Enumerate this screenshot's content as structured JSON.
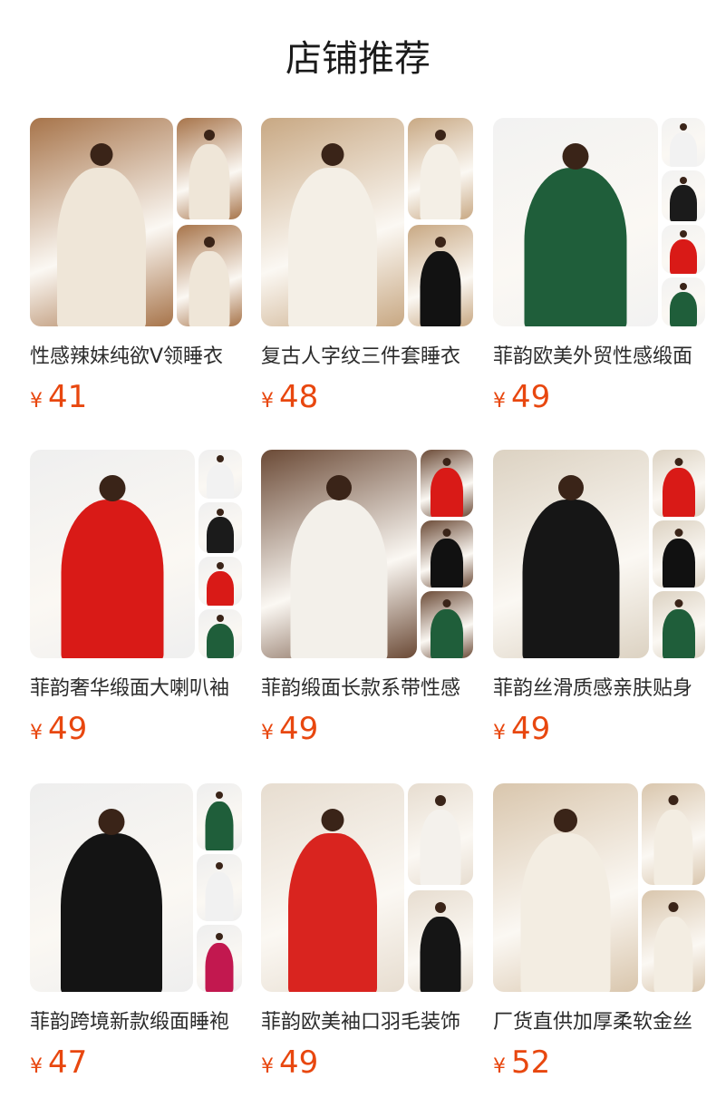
{
  "header": {
    "title": "店铺推荐"
  },
  "currency_symbol": "¥",
  "products": [
    {
      "name": "性感辣妹纯欲V领睡衣",
      "price": "41",
      "scene": "#a7744a",
      "garment": "#efe6d8"
    },
    {
      "name": "复古人字纹三件套睡衣",
      "price": "48",
      "scene": "#c8a883",
      "garment": "#f4efe6"
    },
    {
      "name": "菲韵欧美外贸性感缎面",
      "price": "49",
      "scene": "#f2f2f2",
      "garment": "#1f5e3a"
    },
    {
      "name": "菲韵奢华缎面大喇叭袖",
      "price": "49",
      "scene": "#efefef",
      "garment": "#d91a17"
    },
    {
      "name": "菲韵缎面长款系带性感",
      "price": "49",
      "scene": "#6b4a36",
      "garment": "#f3f0ea"
    },
    {
      "name": "菲韵丝滑质感亲肤贴身",
      "price": "49",
      "scene": "#dcd2c2",
      "garment": "#161616"
    },
    {
      "name": "菲韵跨境新款缎面睡袍",
      "price": "47",
      "scene": "#eeeeee",
      "garment": "#141414"
    },
    {
      "name": "菲韵欧美袖口羽毛装饰",
      "price": "49",
      "scene": "#e7ddd0",
      "garment": "#d9241f"
    },
    {
      "name": "厂货直供加厚柔软金丝",
      "price": "52",
      "scene": "#d9c6ad",
      "garment": "#f3ede2"
    }
  ]
}
